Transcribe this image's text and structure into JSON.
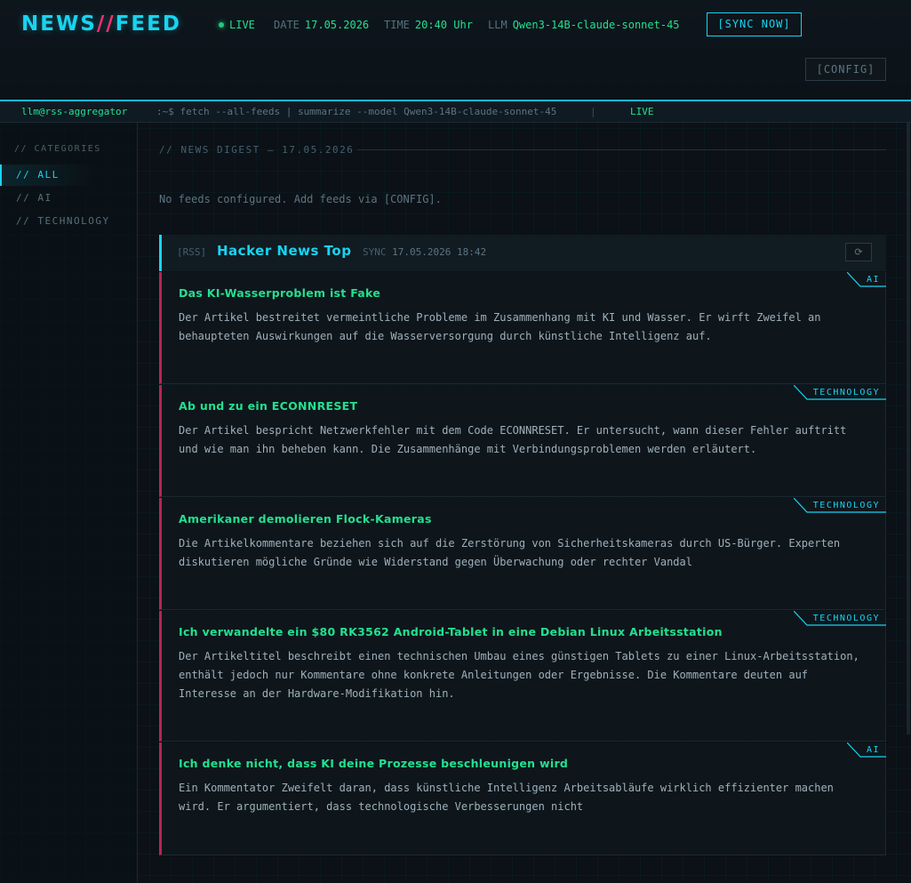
{
  "header": {
    "logo_left": "NEWS",
    "logo_slash": "//",
    "logo_right": "FEED",
    "live_label": "LIVE",
    "date_label": "DATE",
    "date_value": "17.05.2026",
    "time_label": "TIME",
    "time_value": "20:40 Uhr",
    "llm_label": "LLM",
    "llm_value": "Qwen3-14B-claude-sonnet-45",
    "sync_button": "[SYNC NOW]",
    "config_button": "[CONFIG]"
  },
  "terminal": {
    "user": "llm@rss-aggregator",
    "command": ":~$ fetch --all-feeds | summarize --model Qwen3-14B-claude-sonnet-45",
    "separator": "|",
    "status": "LIVE"
  },
  "sidebar": {
    "heading": "// CATEGORIES",
    "items": [
      {
        "label": "// ALL",
        "active": true
      },
      {
        "label": "// AI",
        "active": false
      },
      {
        "label": "// TECHNOLOGY",
        "active": false
      }
    ]
  },
  "main": {
    "digest_heading": "// NEWS DIGEST — 17.05.2026",
    "empty_message": "No feeds configured. Add feeds via [CONFIG].",
    "feed": {
      "tag": "[RSS]",
      "title": "Hacker News Top",
      "sync_label": "SYNC",
      "sync_value": "17.05.2026 18:42",
      "refresh_icon": "⟳"
    },
    "articles": [
      {
        "title": "Das KI-Wasserproblem ist Fake",
        "summary": "Der Artikel bestreitet vermeintliche Probleme im Zusammenhang mit KI und Wasser. Er wirft Zweifel an behaupteten Auswirkungen auf die Wasserversorgung durch künstliche Intelligenz auf.",
        "category": "AI"
      },
      {
        "title": "Ab und zu ein ECONNRESET",
        "summary": "Der Artikel bespricht Netzwerkfehler mit dem Code ECONNRESET. Er untersucht, wann dieser Fehler auftritt und wie man ihn beheben kann. Die Zusammenhänge mit Verbindungsproblemen werden erläutert.",
        "category": "TECHNOLOGY"
      },
      {
        "title": "Amerikaner demolieren Flock-Kameras",
        "summary": "Die Artikelkommentare beziehen sich auf die Zerstörung von Sicherheitskameras durch US-Bürger. Experten diskutieren mögliche Gründe wie Widerstand gegen Überwachung oder rechter Vandal",
        "category": "TECHNOLOGY"
      },
      {
        "title": "Ich verwandelte ein $80 RK3562 Android-Tablet in eine Debian Linux Arbeitsstation",
        "summary": "Der Artikeltitel beschreibt einen technischen Umbau eines günstigen Tablets zu einer Linux-Arbeitsstation, enthält jedoch nur Kommentare ohne konkrete Anleitungen oder Ergebnisse. Die Kommentare deuten auf Interesse an der Hardware-Modifikation hin.",
        "category": "TECHNOLOGY"
      },
      {
        "title": "Ich denke nicht, dass KI deine Prozesse beschleunigen wird",
        "summary": "Ein Kommentator Zweifelt daran, dass künstliche Intelligenz Arbeitsabläufe wirklich effizienter machen wird. Er argumentiert, dass technologische Verbesserungen nicht",
        "category": "AI"
      }
    ]
  },
  "colors": {
    "accent_cyan": "#18d4f0",
    "accent_green": "#23e08f",
    "accent_pink": "#ff2e6d",
    "article_border": "#b72553",
    "background": "#0b1117"
  }
}
